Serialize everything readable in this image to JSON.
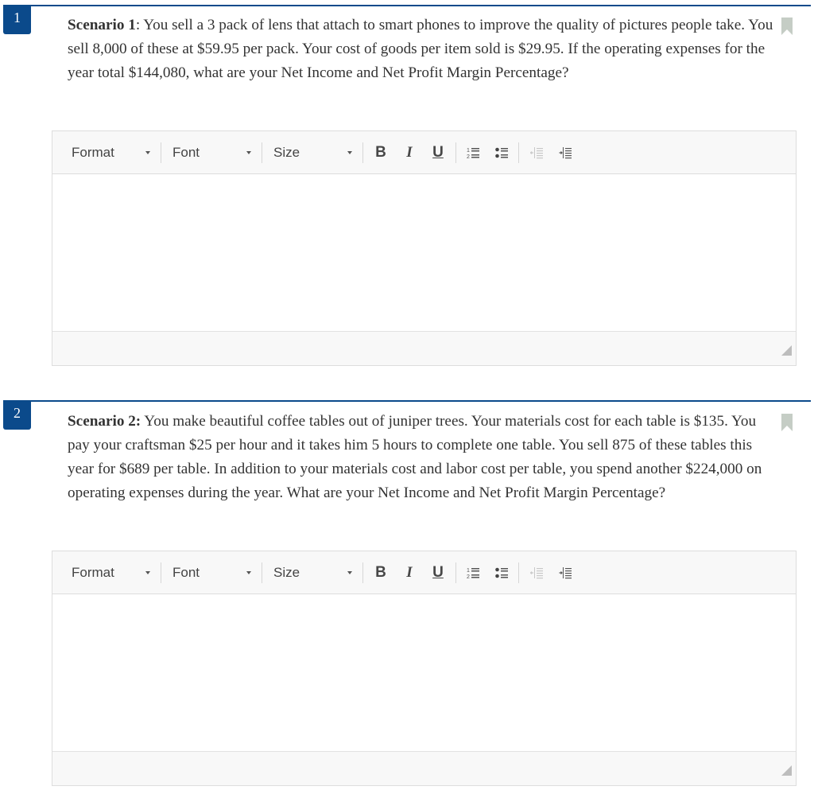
{
  "questions": [
    {
      "number": "1",
      "label": "Scenario 1",
      "label_suffix": ":",
      "text": " You sell a 3 pack of lens that attach to smart phones to improve the quality of pictures people take. You sell 8,000 of these at $59.95 per pack. Your cost of goods per item sold is $29.95. If the operating expenses for the year total $144,080, what are your Net Income and Net Profit Margin Percentage?",
      "answer_value": ""
    },
    {
      "number": "2",
      "label": "Scenario 2:",
      "label_suffix": "",
      "text": " You make beautiful coffee tables out of juniper trees. Your materials cost for each table is $135. You pay your craftsman $25 per hour and it takes him 5 hours to complete one table. You sell 875 of these tables this year for $689 per table. In addition to your materials cost and labor cost per table, you spend another $224,000 on operating expenses during the year. What are your Net Income and Net Profit Margin Percentage?",
      "answer_value": ""
    }
  ],
  "toolbar": {
    "format_label": "Format",
    "font_label": "Font",
    "size_label": "Size",
    "bold_label": "B",
    "italic_label": "I",
    "underline_label": "U",
    "icons": [
      "numbered-list-icon",
      "bulleted-list-icon",
      "outdent-icon",
      "indent-icon"
    ]
  },
  "colors": {
    "accent": "#0b4a8b",
    "bookmark": "#c5cdc5",
    "text": "#333333"
  }
}
